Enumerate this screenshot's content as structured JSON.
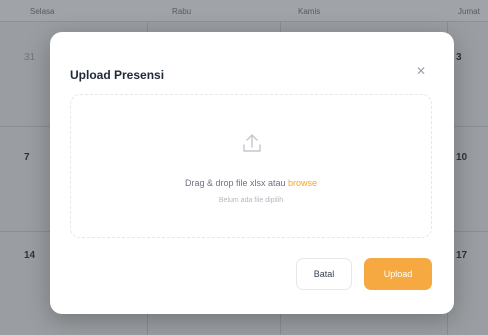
{
  "calendar": {
    "columns": [
      "Selasa",
      "Rabu",
      "Kamis",
      "Jumat"
    ],
    "days": {
      "row1_first": "31",
      "row1_last": "3",
      "row2_first": "7",
      "row2_last": "10",
      "row3_first": "14",
      "row3_last": "17"
    }
  },
  "modal": {
    "title": "Upload Presensi",
    "close_icon": "close-icon",
    "dropzone": {
      "icon": "upload-icon",
      "text_prefix": "Drag & drop file xlsx atau ",
      "browse_label": "browse",
      "status": "Belum ada file dipilih"
    },
    "cancel_label": "Batal",
    "upload_label": "Upload"
  },
  "colors": {
    "accent": "#f5a940",
    "browse_link": "#f5a623",
    "overlay": "#3c4048"
  }
}
